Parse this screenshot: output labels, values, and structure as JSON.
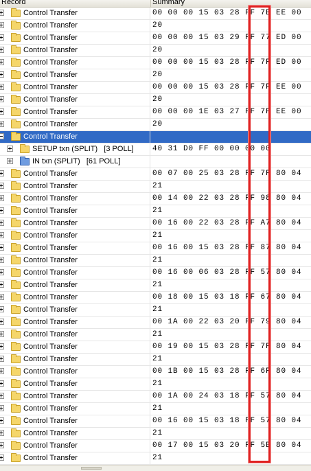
{
  "header": {
    "col1": "Record",
    "col2": "Summary"
  },
  "rows": [
    {
      "level": 0,
      "expander": "plus",
      "icon": "yellow",
      "label": "Control Transfer",
      "summary": "00 00 00 15 03 28 FF 7B EE 00"
    },
    {
      "level": 0,
      "expander": "plus",
      "icon": "yellow",
      "label": "Control Transfer",
      "summary": "20"
    },
    {
      "level": 0,
      "expander": "plus",
      "icon": "yellow",
      "label": "Control Transfer",
      "summary": "00 00 00 15 03 29 FF 77 ED 00"
    },
    {
      "level": 0,
      "expander": "plus",
      "icon": "yellow",
      "label": "Control Transfer",
      "summary": "20"
    },
    {
      "level": 0,
      "expander": "plus",
      "icon": "yellow",
      "label": "Control Transfer",
      "summary": "00 00 00 15 03 28 FF 7F ED 00"
    },
    {
      "level": 0,
      "expander": "plus",
      "icon": "yellow",
      "label": "Control Transfer",
      "summary": "20"
    },
    {
      "level": 0,
      "expander": "plus",
      "icon": "yellow",
      "label": "Control Transfer",
      "summary": "00 00 00 15 03 28 FF 7F EE 00"
    },
    {
      "level": 0,
      "expander": "plus",
      "icon": "yellow",
      "label": "Control Transfer",
      "summary": "20"
    },
    {
      "level": 0,
      "expander": "plus",
      "icon": "yellow",
      "label": "Control Transfer",
      "summary": "00 00 00 1E 03 27 FF 7F EE 00"
    },
    {
      "level": 0,
      "expander": "plus",
      "icon": "yellow",
      "label": "Control Transfer",
      "summary": "20"
    },
    {
      "level": 0,
      "expander": "minus",
      "icon": "yellow",
      "label": "Control Transfer",
      "summary": "",
      "selected": true
    },
    {
      "level": 1,
      "expander": "plus",
      "icon": "yellow",
      "label": "SETUP txn (SPLIT)   [3 POLL]",
      "summary": "40 31 D0 FF 00 00 00 00"
    },
    {
      "level": 1,
      "expander": "plus",
      "icon": "blue",
      "label": "IN txn (SPLIT)   [61 POLL]",
      "summary": ""
    },
    {
      "level": 0,
      "expander": "plus",
      "icon": "yellow",
      "label": "Control Transfer",
      "summary": "00 07 00 25 03 28 FF 7F 80 04"
    },
    {
      "level": 0,
      "expander": "plus",
      "icon": "yellow",
      "label": "Control Transfer",
      "summary": "21"
    },
    {
      "level": 0,
      "expander": "plus",
      "icon": "yellow",
      "label": "Control Transfer",
      "summary": "00 14 00 22 03 28 FF 98 80 04"
    },
    {
      "level": 0,
      "expander": "plus",
      "icon": "yellow",
      "label": "Control Transfer",
      "summary": "21"
    },
    {
      "level": 0,
      "expander": "plus",
      "icon": "yellow",
      "label": "Control Transfer",
      "summary": "00 16 00 22 03 28 FF A7 80 04"
    },
    {
      "level": 0,
      "expander": "plus",
      "icon": "yellow",
      "label": "Control Transfer",
      "summary": "21"
    },
    {
      "level": 0,
      "expander": "plus",
      "icon": "yellow",
      "label": "Control Transfer",
      "summary": "00 16 00 15 03 28 FF 87 80 04"
    },
    {
      "level": 0,
      "expander": "plus",
      "icon": "yellow",
      "label": "Control Transfer",
      "summary": "21"
    },
    {
      "level": 0,
      "expander": "plus",
      "icon": "yellow",
      "label": "Control Transfer",
      "summary": "00 16 00 06 03 28 FF 57 80 04"
    },
    {
      "level": 0,
      "expander": "plus",
      "icon": "yellow",
      "label": "Control Transfer",
      "summary": "21"
    },
    {
      "level": 0,
      "expander": "plus",
      "icon": "yellow",
      "label": "Control Transfer",
      "summary": "00 18 00 15 03 18 FF 67 80 04"
    },
    {
      "level": 0,
      "expander": "plus",
      "icon": "yellow",
      "label": "Control Transfer",
      "summary": "21"
    },
    {
      "level": 0,
      "expander": "plus",
      "icon": "yellow",
      "label": "Control Transfer",
      "summary": "00 1A 00 22 03 20 FF 79 80 04"
    },
    {
      "level": 0,
      "expander": "plus",
      "icon": "yellow",
      "label": "Control Transfer",
      "summary": "21"
    },
    {
      "level": 0,
      "expander": "plus",
      "icon": "yellow",
      "label": "Control Transfer",
      "summary": "00 19 00 15 03 28 FF 7F 80 04"
    },
    {
      "level": 0,
      "expander": "plus",
      "icon": "yellow",
      "label": "Control Transfer",
      "summary": "21"
    },
    {
      "level": 0,
      "expander": "plus",
      "icon": "yellow",
      "label": "Control Transfer",
      "summary": "00 1B 00 15 03 28 FF 6F 80 04"
    },
    {
      "level": 0,
      "expander": "plus",
      "icon": "yellow",
      "label": "Control Transfer",
      "summary": "21"
    },
    {
      "level": 0,
      "expander": "plus",
      "icon": "yellow",
      "label": "Control Transfer",
      "summary": "00 1A 00 24 03 18 FF 57 80 04"
    },
    {
      "level": 0,
      "expander": "plus",
      "icon": "yellow",
      "label": "Control Transfer",
      "summary": "21"
    },
    {
      "level": 0,
      "expander": "plus",
      "icon": "yellow",
      "label": "Control Transfer",
      "summary": "00 16 00 15 03 18 FF 57 80 04"
    },
    {
      "level": 0,
      "expander": "plus",
      "icon": "yellow",
      "label": "Control Transfer",
      "summary": "21"
    },
    {
      "level": 0,
      "expander": "plus",
      "icon": "yellow",
      "label": "Control Transfer",
      "summary": "00 17 00 15 03 20 FF 5B 80 04"
    },
    {
      "level": 0,
      "expander": "plus",
      "icon": "yellow",
      "label": "Control Transfer",
      "summary": "21"
    }
  ],
  "colors": {
    "selection": "#316ac5",
    "highlight_border": "#e02020",
    "folder": "#f5d66a",
    "folder_blue": "#6f9ce0"
  }
}
